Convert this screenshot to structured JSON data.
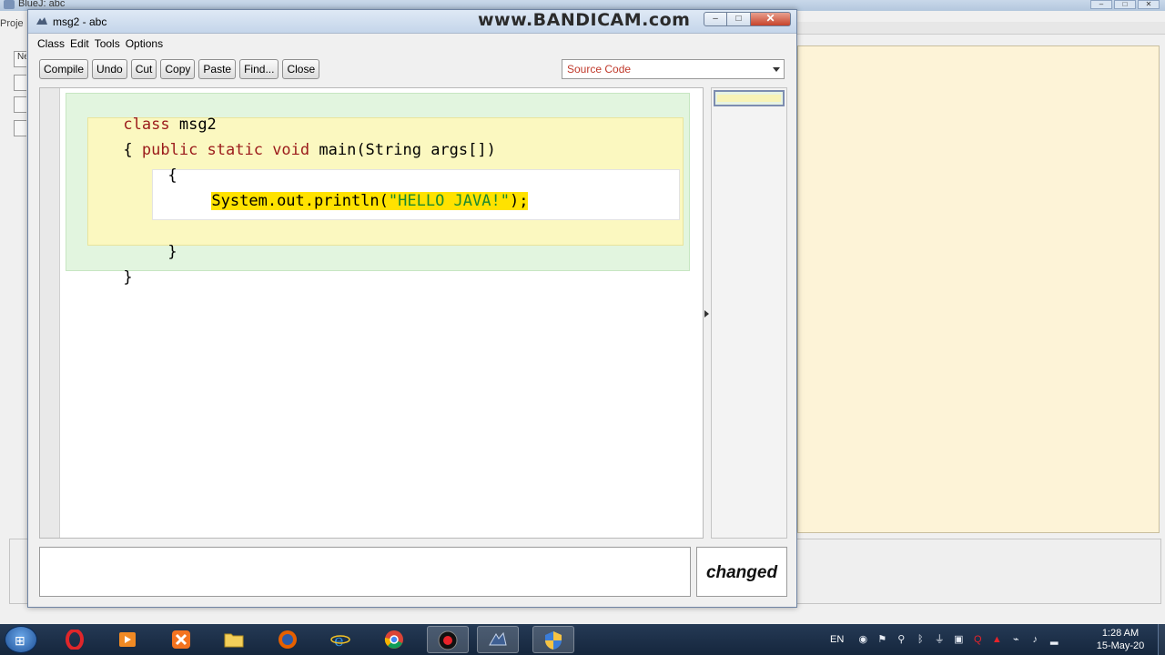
{
  "background_window": {
    "title": "BlueJ: abc",
    "menu_partial": "Proje",
    "side_button_label": "Ne"
  },
  "editor": {
    "title": "msg2 - abc",
    "watermark": "www.BANDICAM.com",
    "window_controls": {
      "minimize": "–",
      "maximize": "□",
      "close": "✕"
    },
    "menu": [
      "Class",
      "Edit",
      "Tools",
      "Options"
    ],
    "toolbar": {
      "compile": "Compile",
      "undo": "Undo",
      "cut": "Cut",
      "copy": "Copy",
      "paste": "Paste",
      "find": "Find...",
      "close": "Close"
    },
    "view_select": {
      "selected": "Source Code"
    },
    "code": {
      "line1_kw": "class",
      "line1_name": " msg2",
      "line2_brace": "{ ",
      "line2_kw": "public static void",
      "line2_rest": " main(String args[])",
      "line3": "{",
      "line4_pre": "System.out.println(",
      "line4_str": "\"HELLO JAVA!\"",
      "line4_post": ");",
      "line5": "}",
      "line6": "}"
    },
    "status": "changed",
    "message": ""
  },
  "taskbar": {
    "apps": [
      "opera",
      "media-player",
      "xampp",
      "file-explorer",
      "firefox",
      "internet-explorer",
      "chrome",
      "bandicam",
      "bluej",
      "security-center"
    ],
    "tray_language": "EN",
    "clock_time": "1:28 AM",
    "clock_date": "15-May-20"
  },
  "colors": {
    "keyword": "#9b1b1b",
    "string": "#1e8a2e",
    "class_scope": "#e2f5df",
    "method_scope": "#fbf8c0",
    "selection": "#ffe200",
    "view_select_text": "#c0392b"
  }
}
